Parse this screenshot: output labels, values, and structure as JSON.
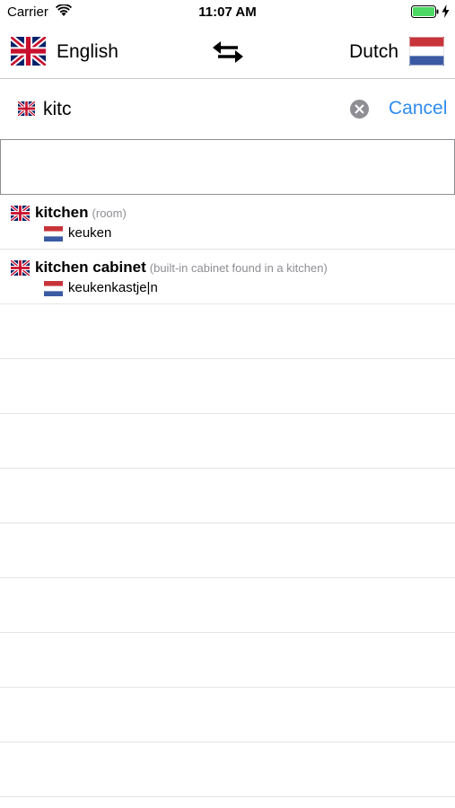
{
  "status_bar": {
    "carrier": "Carrier",
    "time": "11:07 AM",
    "icons": [
      "wifi-icon",
      "battery-icon",
      "charging-bolt-icon"
    ],
    "battery_color": "#4cd964"
  },
  "language_bar": {
    "source_language": "English",
    "target_language": "Dutch",
    "source_flag": "uk-flag-icon",
    "target_flag": "netherlands-flag-icon",
    "swap_icon": "swap-arrows-icon"
  },
  "search": {
    "value": "kitc",
    "cancel_label": "Cancel",
    "accent_color": "#2f8cef"
  },
  "results": [
    {
      "term": "kitchen",
      "note": "(room)",
      "translation": "keuken"
    },
    {
      "term": "kitchen cabinet",
      "note": "(built-in cabinet found in a kitchen)",
      "translation": "keukenkastje|n"
    }
  ]
}
